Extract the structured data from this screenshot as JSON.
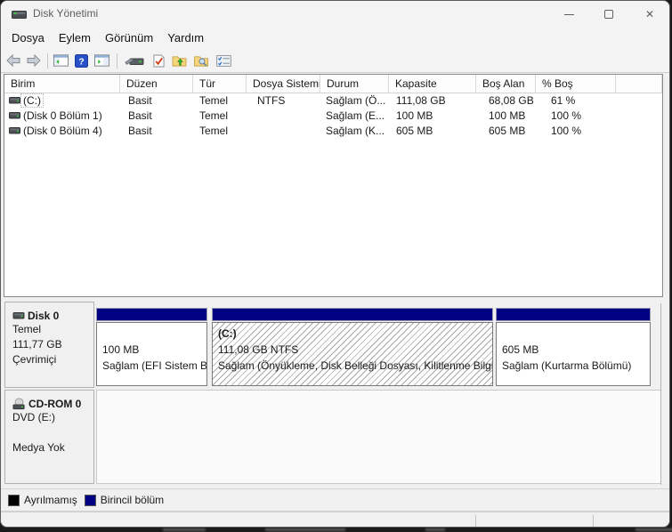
{
  "window": {
    "title": "Disk Yönetimi",
    "icons": {
      "minimize": "─",
      "maximize": "□",
      "close": "✕"
    }
  },
  "menu": {
    "items": [
      {
        "label": "Dosya"
      },
      {
        "label": "Eylem"
      },
      {
        "label": "Görünüm"
      },
      {
        "label": "Yardım"
      }
    ]
  },
  "toolbar": {
    "icons": [
      "back-arrow",
      "forward-arrow",
      "show-console-tree",
      "help",
      "show-action-pane",
      "disk-tool",
      "document-check",
      "folder-up",
      "folder-search",
      "details-list"
    ]
  },
  "volume_list": {
    "columns": [
      "Birim",
      "Düzen",
      "Tür",
      "Dosya Sistemi",
      "Durum",
      "Kapasite",
      "Boş Alan",
      "% Boş"
    ],
    "rows": [
      {
        "name": "(C:)",
        "layout": "Basit",
        "type": "Temel",
        "fs": "NTFS",
        "status": "Sağlam (Ö...",
        "capacity": "111,08 GB",
        "free": "68,08 GB",
        "pct": "61 %"
      },
      {
        "name": "(Disk 0 Bölüm 1)",
        "layout": "Basit",
        "type": "Temel",
        "fs": "",
        "status": "Sağlam (E...",
        "capacity": "100 MB",
        "free": "100 MB",
        "pct": "100 %"
      },
      {
        "name": "(Disk 0 Bölüm 4)",
        "layout": "Basit",
        "type": "Temel",
        "fs": "",
        "status": "Sağlam (K...",
        "capacity": "605 MB",
        "free": "605 MB",
        "pct": "100 %"
      }
    ]
  },
  "disk0": {
    "name": "Disk 0",
    "type": "Temel",
    "size": "111,77 GB",
    "status": "Çevrimiçi",
    "partitions": [
      {
        "name": "",
        "size_fs": "100 MB",
        "status": "Sağlam (EFI Sistem Bö",
        "style": "plain"
      },
      {
        "name": "(C:)",
        "size_fs": "111,08 GB NTFS",
        "status": "Sağlam (Önyükleme, Disk Belleği Dosyası, Kilitlenme Bilgis",
        "style": "hatched"
      },
      {
        "name": "",
        "size_fs": "605 MB",
        "status": "Sağlam (Kurtarma Bölümü)",
        "style": "plain"
      }
    ]
  },
  "cdrom": {
    "name": "CD-ROM 0",
    "media": "DVD (E:)",
    "status": "Medya Yok"
  },
  "legend": {
    "items": [
      {
        "label": "Ayrılmamış",
        "color": "#000000",
        "swatch_style": "background:#000000"
      },
      {
        "label": "Birincil bölüm",
        "color": "#000082",
        "swatch_style": "background:#000082"
      }
    ]
  },
  "colors": {
    "partition_header_navy": "#000082",
    "window_chrome": "#f3f3f3",
    "window_bg": "#f0f0f0",
    "list_bg": "#ffffff"
  }
}
